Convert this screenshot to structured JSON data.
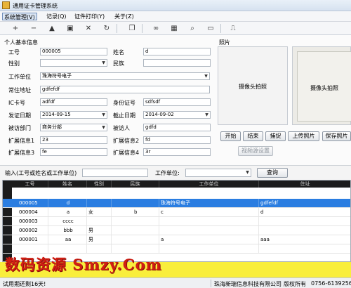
{
  "window": {
    "title": "通用证卡管理系统"
  },
  "menu": [
    {
      "label": "系统管理(V)",
      "active": true
    },
    {
      "label": "记录(Q)"
    },
    {
      "label": "证件打印(Y)"
    },
    {
      "label": "关于(Z)"
    }
  ],
  "toolbar": {
    "buttons": [
      {
        "name": "add-icon",
        "glyph": "+"
      },
      {
        "name": "remove-icon",
        "glyph": "−"
      },
      {
        "name": "up-icon",
        "glyph": "▲"
      },
      {
        "name": "save-icon",
        "glyph": "▣"
      },
      {
        "name": "delete-icon",
        "glyph": "✕"
      },
      {
        "name": "refresh-icon",
        "glyph": "↻"
      },
      {
        "name": "copy-icon",
        "glyph": "❐"
      },
      {
        "name": "binoculars-icon",
        "glyph": "∞"
      },
      {
        "name": "grid-icon",
        "glyph": "▦"
      },
      {
        "name": "magnifier-icon",
        "glyph": "⌕"
      },
      {
        "name": "print-icon",
        "glyph": "▭"
      },
      {
        "name": "tool-icon",
        "glyph": "⎍"
      }
    ]
  },
  "form": {
    "section_title": "个人基本信息",
    "id_label": "工号",
    "id_value": "000005",
    "name_label": "姓名",
    "name_value": "d",
    "gender_label": "性别",
    "gender_value": "",
    "ethnicity_label": "民族",
    "ethnicity_value": "",
    "company_label": "工作单位",
    "company_value": "珠海符号电子",
    "address_label": "常住地址",
    "address_value": "gdfefdf",
    "ic_label": "IC卡号",
    "ic_value": "adfdf",
    "idcard_label": "身份证号",
    "idcard_value": "sdfsdf",
    "issue_label": "发证日期",
    "issue_value": "2014-09-15",
    "expire_label": "截止日期",
    "expire_value": "2014-09-02",
    "dept_label": "被访部门",
    "dept_value": "商务分部",
    "visitor_label": "被访人",
    "visitor_value": "gdfd",
    "ext1_label": "扩展信息1",
    "ext1_value": "23",
    "ext2_label": "扩展信息2",
    "ext2_value": "fd",
    "ext3_label": "扩展信息3",
    "ext3_value": "fe",
    "ext4_label": "扩展信息4",
    "ext4_value": "3r"
  },
  "photo": {
    "section_title": "照片",
    "camera_text_left": "摄像头拍照",
    "camera_text_right": "摄像头拍照",
    "buttons": {
      "start": "开始",
      "stop": "结束",
      "capture": "捕捉",
      "upload": "上传照片",
      "save": "保存照片",
      "video_settings": "视频源设置"
    }
  },
  "search": {
    "label": "输入(工号或姓名或工作单位)",
    "value": "",
    "company_label": "工作单位:",
    "company_value": "",
    "query_button": "查询"
  },
  "table": {
    "columns": [
      "工号",
      "姓名",
      "性别",
      "民族",
      "工作单位",
      "住址"
    ],
    "rows": [
      {
        "id": "000005",
        "name": "d",
        "gender": "",
        "ethnic": "",
        "company": "珠海符号电子",
        "address": "gdfefdf",
        "selected": true
      },
      {
        "id": "000004",
        "name": "a",
        "gender": "女",
        "ethnic": "b",
        "company": "c",
        "address": "d"
      },
      {
        "id": "000003",
        "name": "cccc",
        "gender": "",
        "ethnic": "",
        "company": "",
        "address": ""
      },
      {
        "id": "000002",
        "name": "bbb",
        "gender": "男",
        "ethnic": "",
        "company": "",
        "address": ""
      },
      {
        "id": "000001",
        "name": "aa",
        "gender": "男",
        "ethnic": "",
        "company": "a",
        "address": "aaa"
      },
      {
        "id": "",
        "name": "",
        "gender": "",
        "ethnic": "",
        "company": "",
        "address": ""
      }
    ]
  },
  "watermark": "数码资源 Smzy.Com",
  "status": {
    "trial": "试用期还剩16天!",
    "company": "珠海新瑞信息科技有限公司",
    "copyright": "版权所有",
    "phone": "0756-6139256"
  },
  "colors": {
    "selected_row": "#2a7de1",
    "grid_header": "#1c1c1c",
    "watermark_red": "#d01e14",
    "watermark_band": "#f9ee3c"
  }
}
